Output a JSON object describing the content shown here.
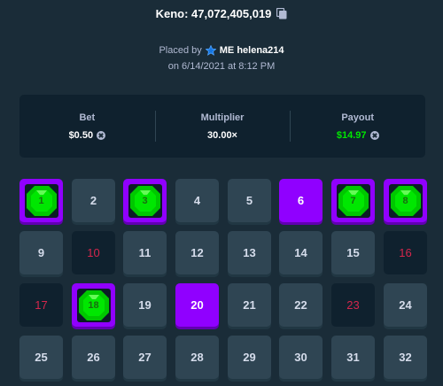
{
  "header": {
    "title": "Keno: 47,072,405,019",
    "placed_by_prefix": "Placed by",
    "user": "ME helena214",
    "date": "on 6/14/2021 at 8:12 PM"
  },
  "stats": {
    "bet_label": "Bet",
    "bet_value": "$0.50",
    "multiplier_label": "Multiplier",
    "multiplier_value": "30.00×",
    "payout_label": "Payout",
    "payout_value": "$14.97"
  },
  "colors": {
    "background": "#1a2c38",
    "panel": "#0f212e",
    "tile": "#2f4553",
    "pick": "#9000ff",
    "gem": "#00e701",
    "unused_text": "#d4264c"
  },
  "tiles": [
    {
      "n": "1",
      "state": "hit"
    },
    {
      "n": "2",
      "state": "normal"
    },
    {
      "n": "3",
      "state": "hit"
    },
    {
      "n": "4",
      "state": "normal"
    },
    {
      "n": "5",
      "state": "normal"
    },
    {
      "n": "6",
      "state": "pick"
    },
    {
      "n": "7",
      "state": "hit"
    },
    {
      "n": "8",
      "state": "hit"
    },
    {
      "n": "9",
      "state": "normal"
    },
    {
      "n": "10",
      "state": "unused"
    },
    {
      "n": "11",
      "state": "normal"
    },
    {
      "n": "12",
      "state": "normal"
    },
    {
      "n": "13",
      "state": "normal"
    },
    {
      "n": "14",
      "state": "normal"
    },
    {
      "n": "15",
      "state": "normal"
    },
    {
      "n": "16",
      "state": "unused"
    },
    {
      "n": "17",
      "state": "unused"
    },
    {
      "n": "18",
      "state": "hit"
    },
    {
      "n": "19",
      "state": "normal"
    },
    {
      "n": "20",
      "state": "pick"
    },
    {
      "n": "21",
      "state": "normal"
    },
    {
      "n": "22",
      "state": "normal"
    },
    {
      "n": "23",
      "state": "unused"
    },
    {
      "n": "24",
      "state": "normal"
    },
    {
      "n": "25",
      "state": "normal"
    },
    {
      "n": "26",
      "state": "normal"
    },
    {
      "n": "27",
      "state": "normal"
    },
    {
      "n": "28",
      "state": "normal"
    },
    {
      "n": "29",
      "state": "normal"
    },
    {
      "n": "30",
      "state": "normal"
    },
    {
      "n": "31",
      "state": "normal"
    },
    {
      "n": "32",
      "state": "normal"
    }
  ]
}
